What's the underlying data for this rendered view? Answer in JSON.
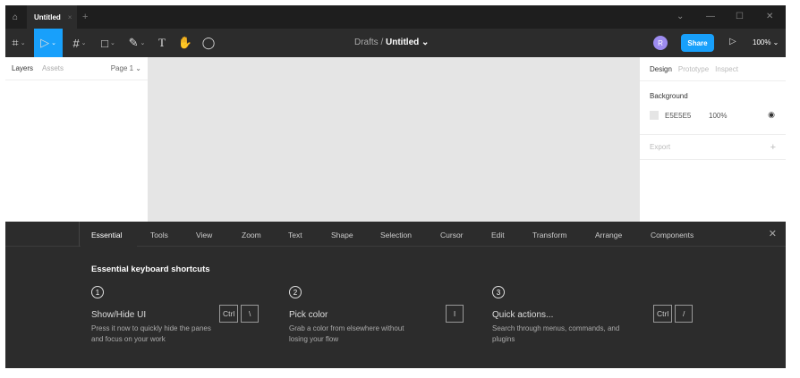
{
  "titlebar": {
    "tab_title": "Untitled",
    "tab_close": "×",
    "new_tab": "+",
    "win_menu": "⌄",
    "minimize": "—",
    "maximize": "☐",
    "close": "✕"
  },
  "toolbar": {
    "breadcrumb_parent": "Drafts",
    "breadcrumb_sep": "/",
    "file_name": "Untitled ⌄",
    "avatar_initial": "R",
    "share_label": "Share",
    "zoom": "100% ⌄"
  },
  "left_panel": {
    "tabs": [
      "Layers",
      "Assets"
    ],
    "page": "Page 1 ⌄"
  },
  "right_panel": {
    "tabs": [
      "Design",
      "Prototype",
      "Inspect"
    ],
    "background_label": "Background",
    "bg_hex": "E5E5E5",
    "bg_opacity": "100%",
    "export_label": "Export",
    "export_add": "+"
  },
  "colors": {
    "accent": "#18a0fb",
    "canvas": "#e5e5e5",
    "avatar": "#9d8cf0"
  },
  "shortcuts": {
    "tabs": [
      "Essential",
      "Tools",
      "View",
      "Zoom",
      "Text",
      "Shape",
      "Selection",
      "Cursor",
      "Edit",
      "Transform",
      "Arrange",
      "Components"
    ],
    "close": "✕",
    "heading": "Essential keyboard shortcuts",
    "items": [
      {
        "num": "1",
        "title": "Show/Hide UI",
        "desc": "Press it now to quickly hide the panes and focus on your work",
        "keys": [
          "Ctrl",
          "\\"
        ]
      },
      {
        "num": "2",
        "title": "Pick color",
        "desc": "Grab a color from elsewhere without losing your flow",
        "keys": [
          "I"
        ]
      },
      {
        "num": "3",
        "title": "Quick actions...",
        "desc": "Search through menus, commands, and plugins",
        "keys": [
          "Ctrl",
          "/"
        ]
      }
    ]
  }
}
